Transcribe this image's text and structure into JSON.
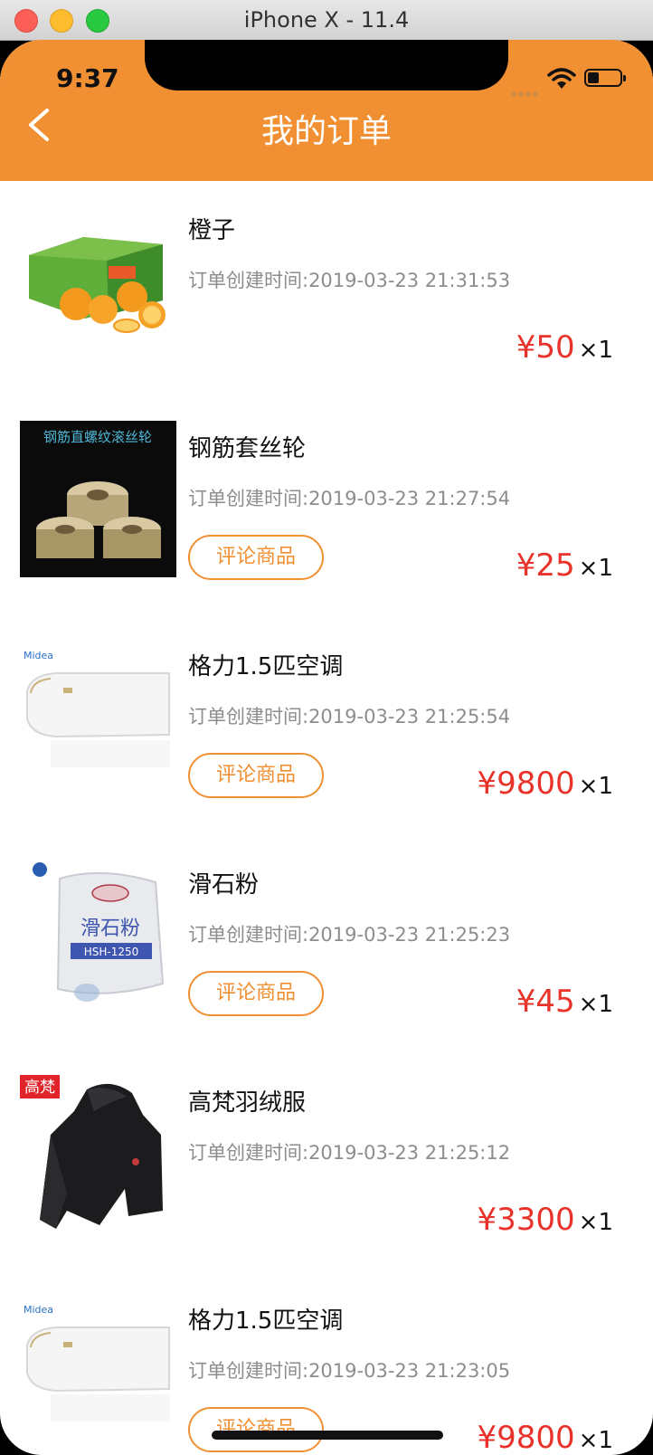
{
  "window": {
    "title": "iPhone X - 11.4"
  },
  "status_bar": {
    "time": "9:37"
  },
  "nav": {
    "title": "我的订单"
  },
  "orders": [
    {
      "name": "橙子",
      "created": "订单创建时间:2019-03-23 21:31:53",
      "price": "¥50",
      "qty": "×1",
      "comment_label": "",
      "thumb": "orange-box"
    },
    {
      "name": "钢筋套丝轮",
      "created": "订单创建时间:2019-03-23 21:27:54",
      "price": "¥25",
      "qty": "×1",
      "comment_label": "评论商品",
      "thumb": "thread-roller",
      "thumb_caption": "钢筋直螺纹滚丝轮"
    },
    {
      "name": "格力1.5匹空调",
      "created": "订单创建时间:2019-03-23 21:25:54",
      "price": "¥9800",
      "qty": "×1",
      "comment_label": "评论商品",
      "thumb": "air-conditioner",
      "thumb_brand": "Midea"
    },
    {
      "name": "滑石粉",
      "created": "订单创建时间:2019-03-23 21:25:23",
      "price": "¥45",
      "qty": "×1",
      "comment_label": "评论商品",
      "thumb": "talc-bag",
      "thumb_caption": "滑石粉",
      "thumb_model": "HSH-1250"
    },
    {
      "name": "高梵羽绒服",
      "created": "订单创建时间:2019-03-23 21:25:12",
      "price": "¥3300",
      "qty": "×1",
      "comment_label": "",
      "thumb": "down-jacket",
      "thumb_brand": "高梵"
    },
    {
      "name": "格力1.5匹空调",
      "created": "订单创建时间:2019-03-23 21:23:05",
      "price": "¥9800",
      "qty": "×1",
      "comment_label": "评论商品",
      "thumb": "air-conditioner",
      "thumb_brand": "Midea"
    }
  ],
  "colors": {
    "accent": "#f19033",
    "price": "#e8322a"
  }
}
